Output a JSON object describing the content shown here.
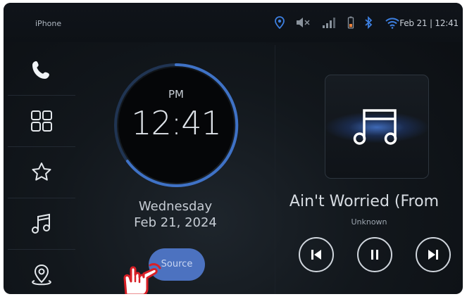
{
  "status_bar": {
    "device_name": "iPhone",
    "datetime": "Feb 21 | 12:41",
    "icons": [
      "location-icon",
      "mute-icon",
      "signal-icon",
      "phone-battery-icon",
      "bluetooth-icon",
      "wifi-icon"
    ],
    "accent_color": "#3d7fe0"
  },
  "sidebar": {
    "items": [
      {
        "name": "phone"
      },
      {
        "name": "apps-grid"
      },
      {
        "name": "favorites-star"
      },
      {
        "name": "music"
      },
      {
        "name": "navigation"
      }
    ]
  },
  "clock": {
    "ampm": "PM",
    "time": "12:41",
    "weekday": "Wednesday",
    "date": "Feb 21, 2024"
  },
  "source_button": {
    "label": "Source",
    "color": "#4c72c0"
  },
  "now_playing": {
    "title": "Ain't Worried (From",
    "artist": "Unknown"
  },
  "controls": [
    "previous-track-icon",
    "pause-icon",
    "next-track-icon"
  ]
}
